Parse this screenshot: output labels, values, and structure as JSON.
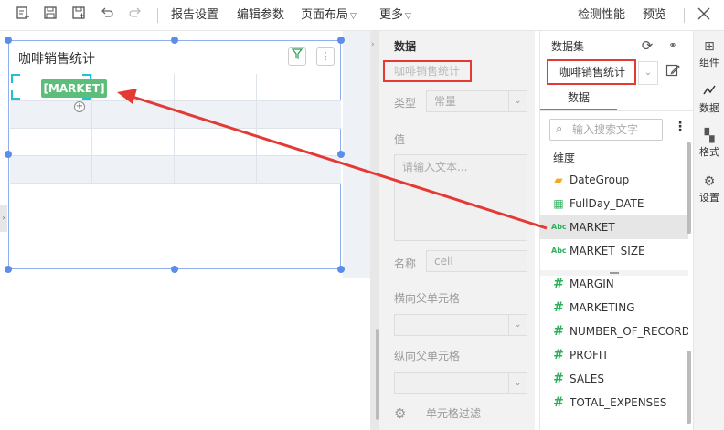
{
  "toolbar": {
    "menus": [
      "报告设置",
      "编辑参数",
      "页面布局",
      "更多"
    ],
    "right_actions": [
      "检测性能",
      "预览"
    ],
    "icons": [
      "new-report-icon",
      "save-icon",
      "save-as-icon",
      "undo-icon",
      "redo-icon",
      "close-icon"
    ]
  },
  "component": {
    "title": "咖啡销售统计",
    "cell_tag": "[MARKET]",
    "filter_icon": "▽",
    "more_icon": "⋮"
  },
  "property_panel": {
    "header": "数据",
    "dataset_name": "咖啡销售统计",
    "type_label": "类型",
    "type_value": "常量",
    "value_label": "值",
    "value_placeholder": "请输入文本...",
    "name_label": "名称",
    "name_value": "cell",
    "h_parent_label": "横向父单元格",
    "v_parent_label": "纵向父单元格",
    "cell_filter_label": "单元格过滤"
  },
  "dataset_panel": {
    "title": "数据集",
    "selected": "咖啡销售统计",
    "tab": "数据",
    "search_placeholder": "输入搜索文字",
    "group_label": "维度",
    "dimensions": [
      {
        "name": "DateGroup",
        "icon": "folder-icon"
      },
      {
        "name": "FullDay_DATE",
        "icon": "calendar-icon"
      },
      {
        "name": "MARKET",
        "icon": "text-field-icon"
      },
      {
        "name": "MARKET_SIZE",
        "icon": "text-field-icon"
      }
    ],
    "measures": [
      "MARGIN",
      "MARKETING",
      "NUMBER_OF_RECORD",
      "PROFIT",
      "SALES",
      "TOTAL_EXPENSES"
    ],
    "abc_label": "Abc",
    "hash_label": "#"
  },
  "side_tabs": [
    "组件",
    "数据",
    "格式",
    "设置"
  ],
  "colors": {
    "accent": "#2cb15a",
    "highlight": "#e53935",
    "selection": "#5b8ee8"
  }
}
